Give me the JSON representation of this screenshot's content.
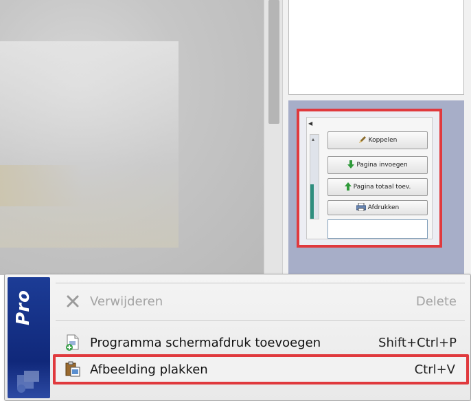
{
  "preview": {
    "buttons": [
      {
        "label": "Koppelen",
        "icon": "pen-icon"
      },
      {
        "label": "Pagina invoegen",
        "icon": "green-arrow-down-icon"
      },
      {
        "label": "Pagina totaal toev.",
        "icon": "green-arrow-up-icon"
      },
      {
        "label": "Afdrukken",
        "icon": "printer-icon"
      }
    ]
  },
  "menu": {
    "brand": "Pro",
    "items": [
      {
        "label": "Verwijderen",
        "shortcut": "Delete",
        "icon": "delete-x-icon",
        "enabled": false
      },
      {
        "label": "Programma schermafdruk toevoegen",
        "shortcut": "Shift+Ctrl+P",
        "icon": "add-screenshot-icon",
        "enabled": true
      },
      {
        "label": "Afbeelding plakken",
        "shortcut": "Ctrl+V",
        "icon": "paste-clipboard-icon",
        "enabled": true,
        "highlighted": true
      }
    ]
  },
  "colors": {
    "highlight": "#e0393d",
    "brand_blue": "#1c3c96",
    "disabled_text": "#a3a3a3"
  }
}
